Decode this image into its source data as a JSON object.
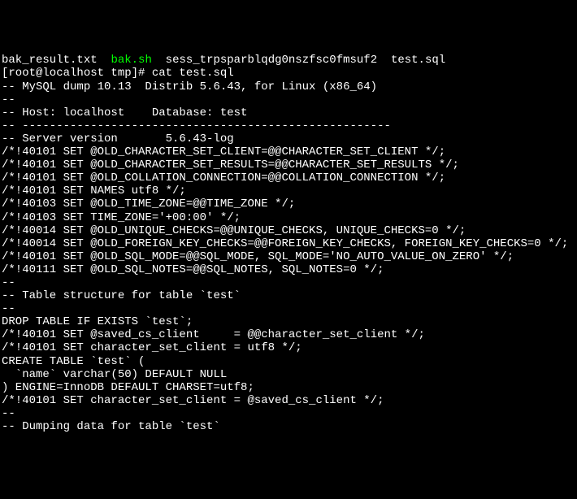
{
  "terminal": {
    "lines": [
      "bak_result.txt  bak.sh  sess_trpsparblqdg0nszfsc0fmsuf2  test.sql",
      "[root@localhost tmp]# cat test.sql",
      "-- MySQL dump 10.13  Distrib 5.6.43, for Linux (x86_64)",
      "--",
      "-- Host: localhost    Database: test",
      "-- ------------------------------------------------------",
      "-- Server version       5.6.43-log",
      "",
      "/*!40101 SET @OLD_CHARACTER_SET_CLIENT=@@CHARACTER_SET_CLIENT */;",
      "/*!40101 SET @OLD_CHARACTER_SET_RESULTS=@@CHARACTER_SET_RESULTS */;",
      "/*!40101 SET @OLD_COLLATION_CONNECTION=@@COLLATION_CONNECTION */;",
      "/*!40101 SET NAMES utf8 */;",
      "/*!40103 SET @OLD_TIME_ZONE=@@TIME_ZONE */;",
      "/*!40103 SET TIME_ZONE='+00:00' */;",
      "/*!40014 SET @OLD_UNIQUE_CHECKS=@@UNIQUE_CHECKS, UNIQUE_CHECKS=0 */;",
      "/*!40014 SET @OLD_FOREIGN_KEY_CHECKS=@@FOREIGN_KEY_CHECKS, FOREIGN_KEY_CHECKS=0 */;",
      "/*!40101 SET @OLD_SQL_MODE=@@SQL_MODE, SQL_MODE='NO_AUTO_VALUE_ON_ZERO' */;",
      "/*!40111 SET @OLD_SQL_NOTES=@@SQL_NOTES, SQL_NOTES=0 */;",
      "",
      "--",
      "-- Table structure for table `test`",
      "--",
      "",
      "DROP TABLE IF EXISTS `test`;",
      "/*!40101 SET @saved_cs_client     = @@character_set_client */;",
      "/*!40101 SET character_set_client = utf8 */;",
      "CREATE TABLE `test` (",
      "  `name` varchar(50) DEFAULT NULL",
      ") ENGINE=InnoDB DEFAULT CHARSET=utf8;",
      "/*!40101 SET character_set_client = @saved_cs_client */;",
      "",
      "--",
      "-- Dumping data for table `test`"
    ],
    "highlight_file": "bak.sh"
  }
}
